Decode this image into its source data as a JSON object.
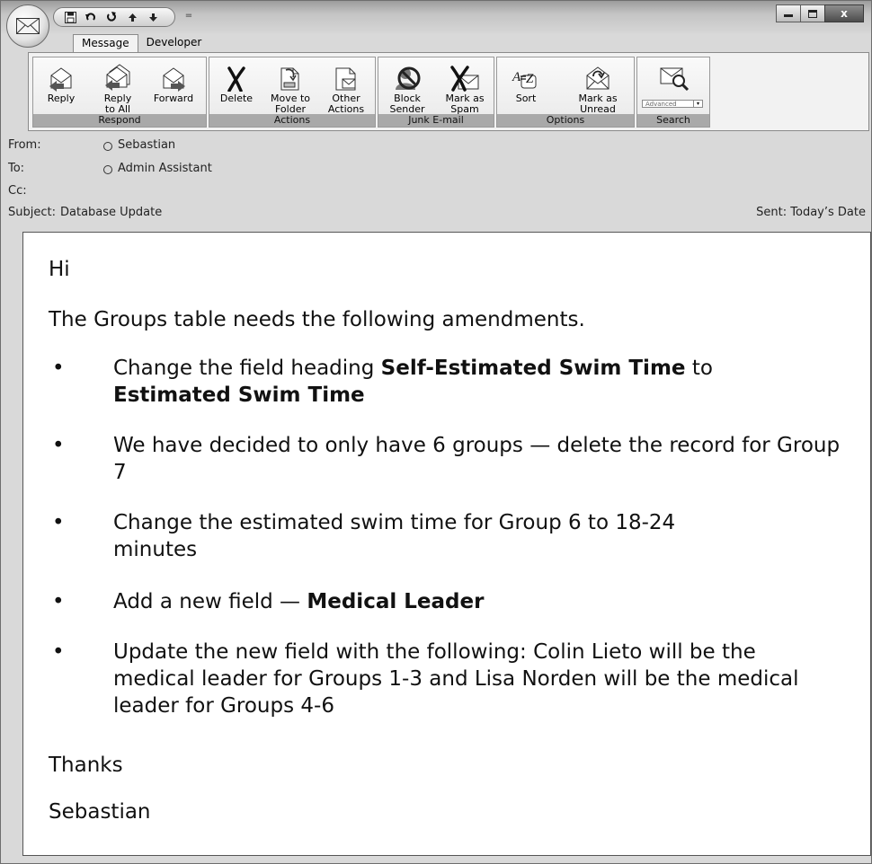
{
  "quick_access": {
    "icons": [
      "save-icon",
      "undo-icon",
      "redo-icon",
      "up-arrow-icon",
      "down-arrow-icon"
    ],
    "customize_glyph": "="
  },
  "window_controls": {
    "minimize": "–",
    "maximize": "□",
    "close": "x"
  },
  "tabs": [
    {
      "label": "Message",
      "active": true
    },
    {
      "label": "Developer",
      "active": false
    }
  ],
  "ribbon": {
    "respond": {
      "label": "Respond",
      "buttons": [
        {
          "label": "Reply",
          "icon": "reply-icon"
        },
        {
          "label": "Reply\nto All",
          "icon": "reply-all-icon"
        },
        {
          "label": "Forward",
          "icon": "forward-icon"
        }
      ]
    },
    "actions": {
      "label": "Actions",
      "buttons": [
        {
          "label": "Delete",
          "icon": "delete-x-icon"
        },
        {
          "label": "Move to\nFolder",
          "icon": "move-to-folder-icon"
        },
        {
          "label": "Other\nActions",
          "icon": "other-actions-icon"
        }
      ]
    },
    "junk": {
      "label": "Junk E-mail",
      "buttons": [
        {
          "label": "Block\nSender",
          "icon": "block-sender-icon"
        },
        {
          "label": "Mark as\nSpam",
          "icon": "mark-spam-icon"
        }
      ]
    },
    "options": {
      "label": "Options",
      "buttons": [
        {
          "label": "Sort",
          "icon": "sort-az-icon"
        },
        {
          "label": "Mark as\nUnread",
          "icon": "mark-unread-icon"
        }
      ]
    },
    "search": {
      "label": "Search",
      "advanced_label": "Advanced",
      "dropdown_glyph": "▾",
      "icon": "search-mail-icon"
    }
  },
  "header": {
    "from_label": "From:",
    "from_value": "Sebastian",
    "to_label": "To:",
    "to_value": "Admin Assistant",
    "cc_label": "Cc:",
    "subject_label": "Subject:",
    "subject_value": "Database Update",
    "sent_label": "Sent:",
    "sent_value": "Today’s Date"
  },
  "message": {
    "greeting": "Hi",
    "intro": "The Groups table needs the following amendments.",
    "bullet_glyph": "•",
    "bullets": [
      {
        "a": "Change the field heading ",
        "b": "Self-Estimated Swim Time",
        "c": " to ",
        "d": "Estimated Swim Time"
      },
      {
        "text": "We have decided to only have 6 groups — delete the record for Group 7"
      },
      {
        "text": "Change the estimated swim time for Group 6 to 18-24 minutes"
      },
      {
        "a": "Add a new field — ",
        "b": "Medical Leader"
      },
      {
        "text": "Update the new field with the following:  Colin Lieto will be the medical leader for Groups 1-3 and Lisa Norden will be the medical leader for Groups 4-6"
      }
    ],
    "closing": "Thanks",
    "signature": "Sebastian"
  }
}
